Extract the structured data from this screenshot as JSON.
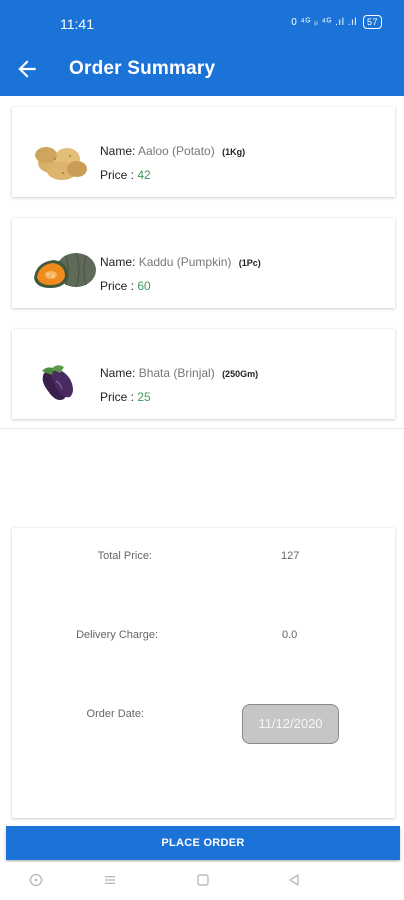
{
  "status_bar": {
    "time": "11:41",
    "indicators": "0 ⁴ᴳ ᵢₗ ⁴ᴳ .ıl .ıl",
    "battery": "57"
  },
  "app_bar": {
    "title": "Order Summary",
    "back_icon": "arrow-left-icon",
    "color": "#1b73d8"
  },
  "items": [
    {
      "name_label": "Name:",
      "name": "Aaloo (Potato)",
      "quantity": "(1Kg)",
      "price_label": "Price :",
      "price": "42",
      "image": "potato-image"
    },
    {
      "name_label": "Name:",
      "name": "Kaddu (Pumpkin)",
      "quantity": "(1Pc)",
      "price_label": "Price :",
      "price": "60",
      "image": "pumpkin-image"
    },
    {
      "name_label": "Name:",
      "name": "Bhata (Brinjal)",
      "quantity": "(250Gm)",
      "price_label": "Price :",
      "price": "25",
      "image": "brinjal-image"
    }
  ],
  "summary": {
    "total_label": "Total Price:",
    "total_value": "127",
    "delivery_label": "Delivery Charge:",
    "delivery_value": "0.0",
    "date_label": "Order Date:",
    "date_value": "11/12/2020"
  },
  "place_order_label": "PLACE ORDER",
  "nav_icons": [
    "circle-icon",
    "menu-icon",
    "square-icon",
    "back-triangle-icon"
  ],
  "colors": {
    "primary": "#1b73d8",
    "price": "#3e9a5a"
  }
}
